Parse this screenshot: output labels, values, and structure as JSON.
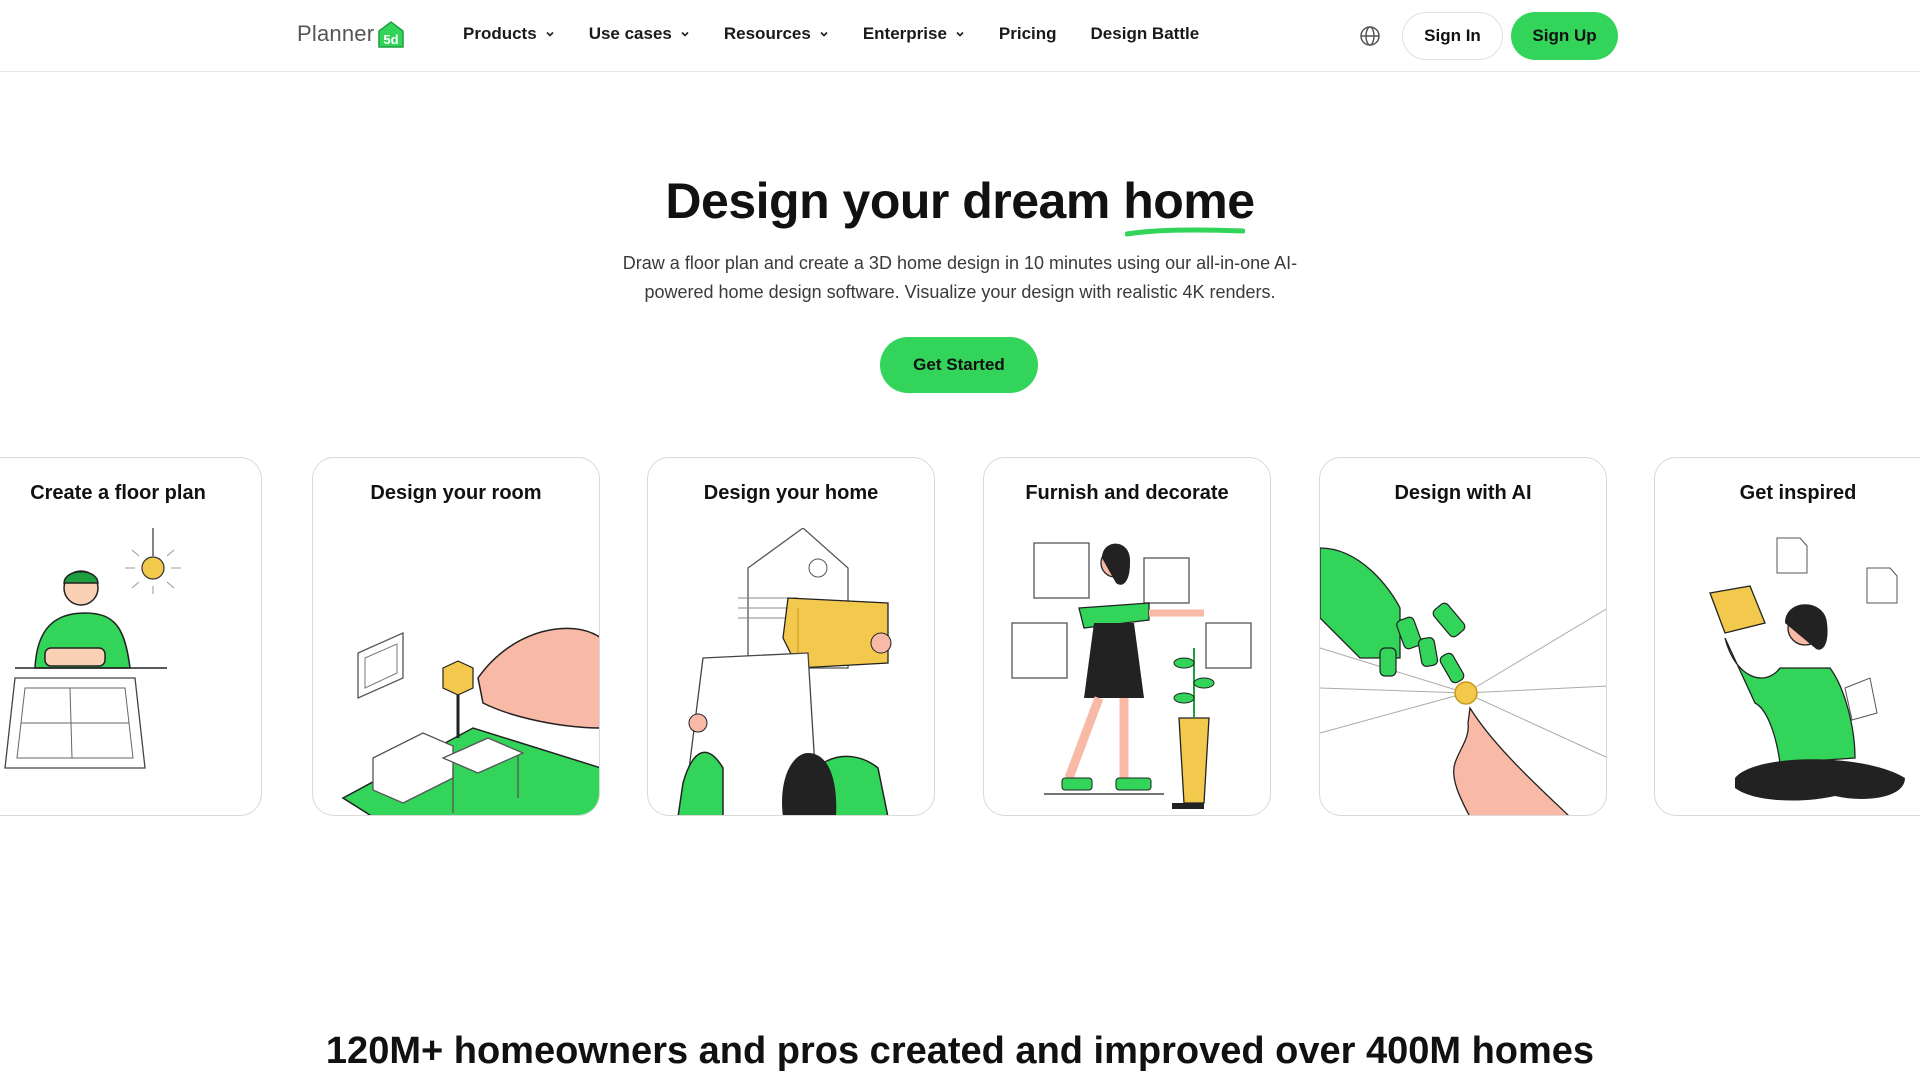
{
  "brand": {
    "logo_text": "Planner",
    "logo_mark_text": "5d",
    "accent_color": "#33d45a"
  },
  "nav": {
    "items": [
      {
        "label": "Products",
        "has_dropdown": true
      },
      {
        "label": "Use cases",
        "has_dropdown": true
      },
      {
        "label": "Resources",
        "has_dropdown": true
      },
      {
        "label": "Enterprise",
        "has_dropdown": true
      },
      {
        "label": "Pricing",
        "has_dropdown": false
      },
      {
        "label": "Design Battle",
        "has_dropdown": false
      }
    ],
    "language_icon": "globe-icon",
    "sign_in_label": "Sign In",
    "sign_up_label": "Sign Up"
  },
  "hero": {
    "title_prefix": "Design your dream ",
    "title_highlight": "home",
    "subtitle": "Draw a floor plan and create a 3D home design in 10 minutes using our all-in-one AI-powered home design software. Visualize your design with realistic 4K renders.",
    "cta_label": "Get Started"
  },
  "cards": [
    {
      "title": "Create a floor plan"
    },
    {
      "title": "Design your room"
    },
    {
      "title": "Design your home"
    },
    {
      "title": "Furnish and decorate"
    },
    {
      "title": "Design with AI"
    },
    {
      "title": "Get inspired"
    }
  ],
  "stats": {
    "headline": "120M+ homeowners and pros created and improved over 400M homes"
  }
}
